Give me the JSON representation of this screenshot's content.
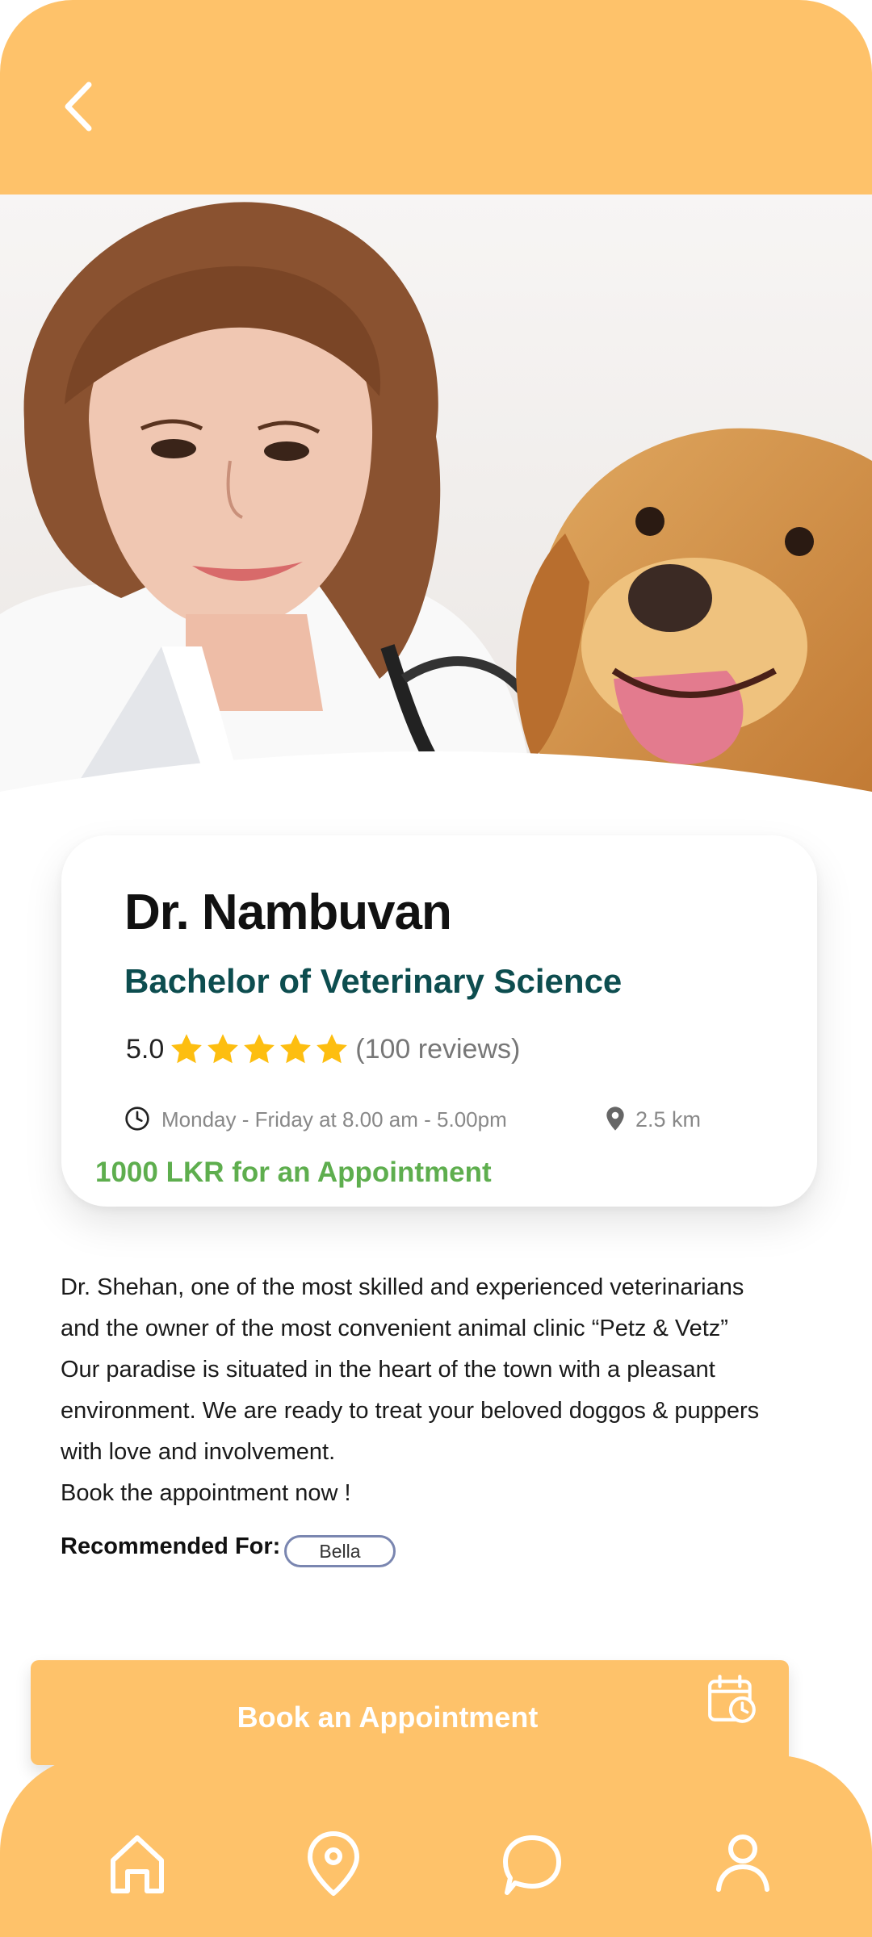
{
  "doctor": {
    "name": "Dr. Nambuvan",
    "degree": "Bachelor of Veterinary Science",
    "rating": "5.0",
    "stars": 5,
    "reviews": "(100 reviews)",
    "hours": "Monday - Friday at 8.00 am - 5.00pm",
    "distance": "2.5 km",
    "price": "1000 LKR for an Appointment"
  },
  "about": {
    "text": "Dr. Shehan, one of the most skilled and experienced veterinarians\nand the owner of the most convenient animal clinic “Petz & Vetz”\nOur paradise is situated in the heart of the town with a pleasant\nenvironment. We are ready to treat your beloved doggos & puppers\nwith love and involvement.\nBook the appointment now !"
  },
  "recommended": {
    "label": "Recommended For:",
    "pet": "Bella"
  },
  "book_button": {
    "label": "Book an Appointment"
  },
  "icons": {
    "back": "chevron-left-icon",
    "star": "star-icon",
    "clock": "clock-icon",
    "location": "map-pin-icon",
    "calendar": "calendar-clock-icon",
    "nav": [
      "home-icon",
      "map-pin-icon",
      "chat-icon",
      "user-icon"
    ]
  },
  "colors": {
    "accent": "#FEC26A",
    "degree": "#0d4d4f",
    "price": "#5eae4e",
    "star": "#FDBE10",
    "chip_border": "#7a86b0"
  }
}
